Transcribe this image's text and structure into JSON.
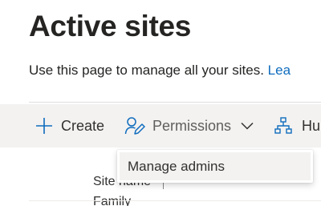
{
  "page": {
    "title": "Active sites",
    "description": "Use this page to manage all your sites. ",
    "description_link": "Lea"
  },
  "toolbar": {
    "create": {
      "label": "Create",
      "icon": "plus-icon"
    },
    "permissions": {
      "label": "Permissions",
      "icon": "person-edit-icon",
      "chevron": "chevron-down-icon"
    },
    "hub": {
      "label": "Hu",
      "icon": "hub-org-chart-icon"
    }
  },
  "permissions_menu": {
    "items": [
      {
        "label": "Manage admins"
      }
    ]
  },
  "table": {
    "columns": [
      {
        "label": "Site name"
      }
    ],
    "rows": [
      {
        "site_name": "Family"
      }
    ]
  },
  "colors": {
    "link": "#0f6cbd",
    "toolbar_bg": "#f3f2f1",
    "icon_blue": "#0f6cbd"
  }
}
